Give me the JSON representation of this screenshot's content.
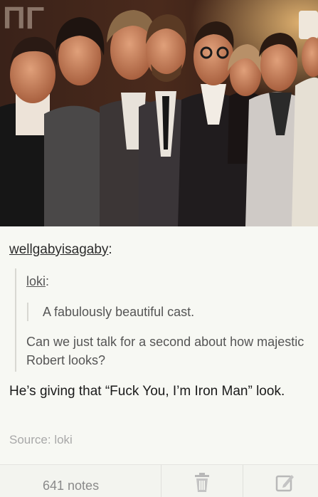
{
  "post": {
    "photo_alt": "",
    "reblogger": {
      "name": "wellgabyisagaby",
      "suffix": ":"
    },
    "quote": {
      "source_name": "loki",
      "source_suffix": ":",
      "inner_text": "A fabulously beautiful cast.",
      "body_text": "Can we just talk for a second about how majestic Robert looks?"
    },
    "comment": "He’s giving that “Fuck You, I’m Iron Man” look.",
    "source": {
      "label": "Source:",
      "name": "loki"
    }
  },
  "footer": {
    "notes_label": "641 notes",
    "delete_icon": "trash-icon",
    "edit_icon": "edit-icon"
  },
  "colors": {
    "background": "#f7f8f3",
    "text_primary": "#1a1a1a",
    "text_secondary": "#555555",
    "text_muted": "#a8a8a8",
    "quote_border": "#d8d8d2"
  }
}
